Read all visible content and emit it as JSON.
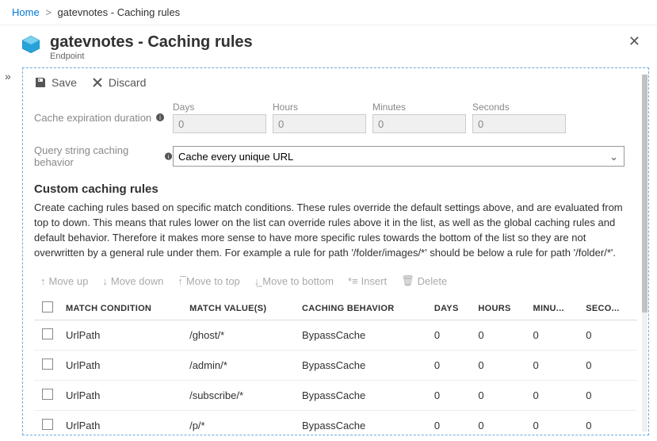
{
  "breadcrumb": {
    "home": "Home",
    "current": "gatevnotes - Caching rules"
  },
  "header": {
    "title": "gatevnotes - Caching rules",
    "subtitle": "Endpoint"
  },
  "toolbar": {
    "save": "Save",
    "discard": "Discard"
  },
  "form": {
    "expiration_label": "Cache expiration duration",
    "days_label": "Days",
    "days_value": "0",
    "hours_label": "Hours",
    "hours_value": "0",
    "minutes_label": "Minutes",
    "minutes_value": "0",
    "seconds_label": "Seconds",
    "seconds_value": "0",
    "qsc_label": "Query string caching behavior",
    "qsc_value": "Cache every unique URL"
  },
  "section": {
    "title": "Custom caching rules",
    "desc": "Create caching rules based on specific match conditions. These rules override the default settings above, and are evaluated from top to down. This means that rules lower on the list can override rules above it in the list, as well as the global caching rules and default behavior. Therefore it makes more sense to have more specific rules towards the bottom of the list so they are not overwritten by a general rule under them. For example a rule for path '/folder/images/*' should be below a rule for path '/folder/*'."
  },
  "tableToolbar": {
    "move_up": "Move up",
    "move_down": "Move down",
    "move_top": "Move to top",
    "move_bottom": "Move to bottom",
    "insert": "Insert",
    "delete": "Delete"
  },
  "columns": {
    "cond": "MATCH CONDITION",
    "val": "MATCH VALUE(S)",
    "beh": "CACHING BEHAVIOR",
    "days": "DAYS",
    "hours": "HOURS",
    "min": "MINU...",
    "sec": "SECO..."
  },
  "rows": [
    {
      "cond": "UrlPath",
      "val": "/ghost/*",
      "beh": "BypassCache",
      "d": "0",
      "h": "0",
      "m": "0",
      "s": "0"
    },
    {
      "cond": "UrlPath",
      "val": "/admin/*",
      "beh": "BypassCache",
      "d": "0",
      "h": "0",
      "m": "0",
      "s": "0"
    },
    {
      "cond": "UrlPath",
      "val": "/subscribe/*",
      "beh": "BypassCache",
      "d": "0",
      "h": "0",
      "m": "0",
      "s": "0"
    },
    {
      "cond": "UrlPath",
      "val": "/p/*",
      "beh": "BypassCache",
      "d": "0",
      "h": "0",
      "m": "0",
      "s": "0"
    }
  ]
}
